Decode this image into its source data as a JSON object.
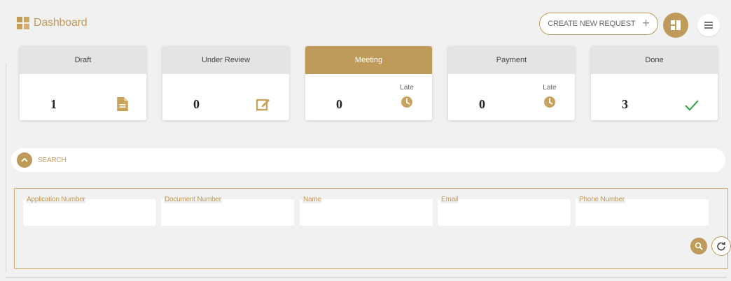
{
  "header": {
    "title": "Dashboard",
    "create_label": "CREATE NEW REQUEST",
    "create_icon": "plus-icon",
    "view_grid_icon": "grid-view-icon",
    "view_list_icon": "list-view-icon"
  },
  "colors": {
    "accent": "#bf9b5a",
    "success": "#2e9e3f",
    "card_header": "#e4e4e4",
    "background": "#f1f1f1"
  },
  "cards": [
    {
      "label": "Draft",
      "count": "1",
      "late": "",
      "icon": "document-icon",
      "active": false
    },
    {
      "label": "Under Review",
      "count": "0",
      "late": "",
      "icon": "edit-icon",
      "active": false
    },
    {
      "label": "Meeting",
      "count": "0",
      "late": "Late",
      "icon": "clock-icon",
      "active": true
    },
    {
      "label": "Payment",
      "count": "0",
      "late": "Late",
      "icon": "clock-icon",
      "active": false
    },
    {
      "label": "Done",
      "count": "3",
      "late": "",
      "icon": "check-icon",
      "active": false
    }
  ],
  "search": {
    "label": "SEARCH",
    "toggle_icon": "chevron-up-icon",
    "fields": [
      {
        "label": "Application Number",
        "value": ""
      },
      {
        "label": "Document Number",
        "value": ""
      },
      {
        "label": "Name",
        "value": ""
      },
      {
        "label": "Email",
        "value": ""
      },
      {
        "label": "Phone Number",
        "value": ""
      }
    ],
    "search_icon": "search-icon",
    "reset_icon": "refresh-icon"
  }
}
